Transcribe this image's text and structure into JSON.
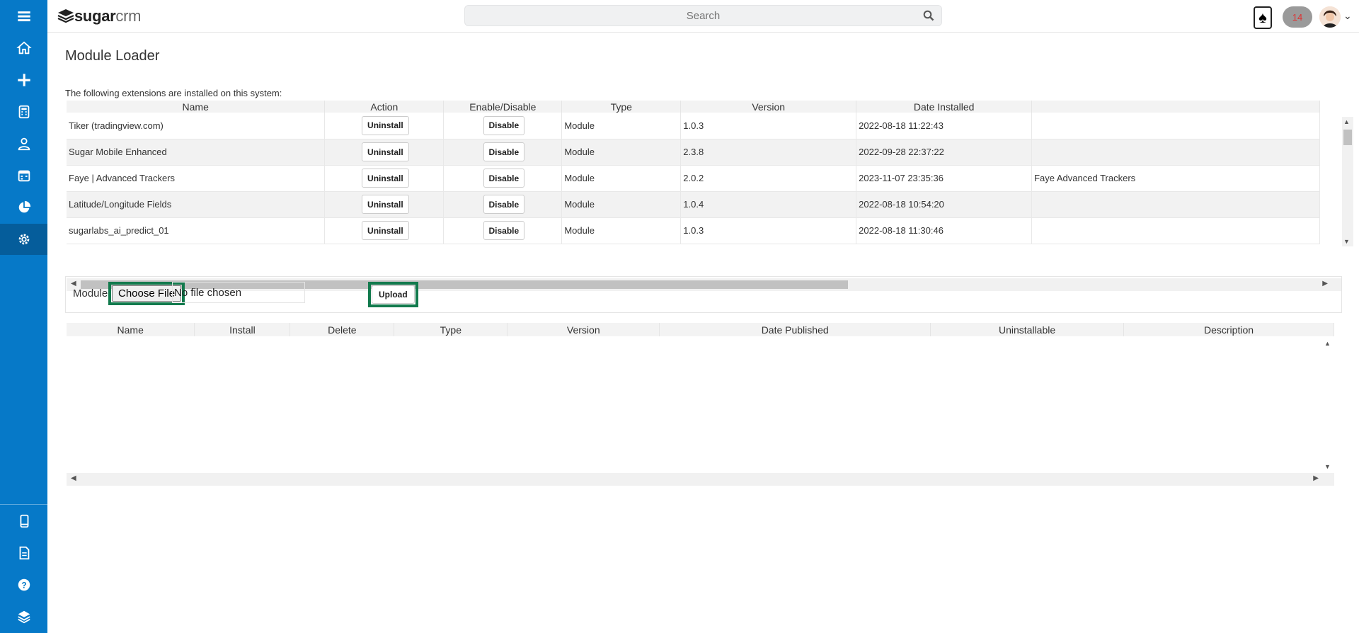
{
  "app": {
    "logo_bold": "sugar",
    "logo_light": "crm",
    "search_placeholder": "Search",
    "notification_count": "14"
  },
  "page": {
    "title": "Module Loader",
    "installed_caption": "The following extensions are installed on this system:"
  },
  "installed": {
    "columns": [
      "Name",
      "Action",
      "Enable/Disable",
      "Type",
      "Version",
      "Date Installed",
      ""
    ],
    "rows": [
      {
        "name": "Tiker (tradingview.com)",
        "action": "Uninstall",
        "toggle": "Disable",
        "type": "Module",
        "version": "1.0.3",
        "date": "2022-08-18 11:22:43",
        "description": ""
      },
      {
        "name": "Sugar Mobile Enhanced",
        "action": "Uninstall",
        "toggle": "Disable",
        "type": "Module",
        "version": "2.3.8",
        "date": "2022-09-28 22:37:22",
        "description": ""
      },
      {
        "name": "Faye | Advanced Trackers",
        "action": "Uninstall",
        "toggle": "Disable",
        "type": "Module",
        "version": "2.0.2",
        "date": "2023-11-07 23:35:36",
        "description": "Faye Advanced Trackers"
      },
      {
        "name": "Latitude/Longitude Fields",
        "action": "Uninstall",
        "toggle": "Disable",
        "type": "Module",
        "version": "1.0.4",
        "date": "2022-08-18 10:54:20",
        "description": ""
      },
      {
        "name": "sugarlabs_ai_predict_01",
        "action": "Uninstall",
        "toggle": "Disable",
        "type": "Module",
        "version": "1.0.3",
        "date": "2022-08-18 11:30:46",
        "description": ""
      }
    ]
  },
  "upload": {
    "module_label": "Module",
    "choose_label": "Choose File",
    "file_status": "No file chosen",
    "upload_label": "Upload"
  },
  "available": {
    "columns": [
      "Name",
      "Install",
      "Delete",
      "Type",
      "Version",
      "Date Published",
      "Uninstallable",
      "Description"
    ]
  },
  "icons": {
    "sidebar_top": [
      "menu-icon",
      "home-icon",
      "plus-icon",
      "calculator-icon",
      "user-icon",
      "calendar-icon",
      "pie-chart-icon",
      "gear-icon"
    ],
    "sidebar_bottom": [
      "mobile-icon",
      "document-icon",
      "help-icon",
      "layers-icon"
    ]
  },
  "colors": {
    "sidebar": "#0679c8",
    "sidebar_active": "#055d9b",
    "highlight_border": "#127a4d"
  }
}
